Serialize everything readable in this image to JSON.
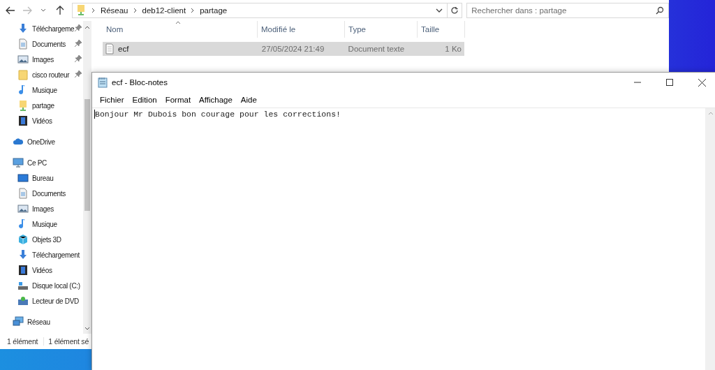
{
  "explorer": {
    "address": {
      "path": [
        "Réseau",
        "deb12-client",
        "partage"
      ]
    },
    "search": {
      "placeholder": "Rechercher dans : partage"
    },
    "sidebar": {
      "quick_access": [
        {
          "label": "Téléchargeme",
          "kind": "download",
          "pinned": true
        },
        {
          "label": "Documents",
          "kind": "document",
          "pinned": true
        },
        {
          "label": "Images",
          "kind": "image",
          "pinned": true
        },
        {
          "label": "cisco routeur",
          "kind": "folder",
          "pinned": true
        },
        {
          "label": "Musique",
          "kind": "music",
          "pinned": false
        },
        {
          "label": "partage",
          "kind": "share",
          "pinned": false
        },
        {
          "label": "Vidéos",
          "kind": "video",
          "pinned": false
        }
      ],
      "tree": [
        {
          "label": "OneDrive",
          "kind": "cloud"
        },
        {
          "label": "Ce PC",
          "kind": "pc",
          "children": [
            {
              "label": "Bureau",
              "kind": "desktop"
            },
            {
              "label": "Documents",
              "kind": "document"
            },
            {
              "label": "Images",
              "kind": "image"
            },
            {
              "label": "Musique",
              "kind": "music"
            },
            {
              "label": "Objets 3D",
              "kind": "cube"
            },
            {
              "label": "Téléchargement",
              "kind": "download"
            },
            {
              "label": "Vidéos",
              "kind": "video"
            },
            {
              "label": "Disque local (C:)",
              "kind": "drive"
            },
            {
              "label": "Lecteur de DVD",
              "kind": "dvd"
            }
          ]
        },
        {
          "label": "Réseau",
          "kind": "network"
        }
      ]
    },
    "table": {
      "columns": [
        "Nom",
        "Modifié le",
        "Type",
        "Taille"
      ],
      "rows": [
        {
          "cells": [
            "ecf",
            "27/05/2024 21:49",
            "Document texte",
            "1 Ko"
          ],
          "selected": true
        }
      ]
    },
    "status_bar": [
      "1 élément",
      "1 élément sé"
    ]
  },
  "notepad": {
    "title": "ecf - Bloc-notes",
    "menu": [
      "Fichier",
      "Edition",
      "Format",
      "Affichage",
      "Aide"
    ],
    "text": "Bonjour Mr Dubois bon courage pour les corrections!"
  }
}
